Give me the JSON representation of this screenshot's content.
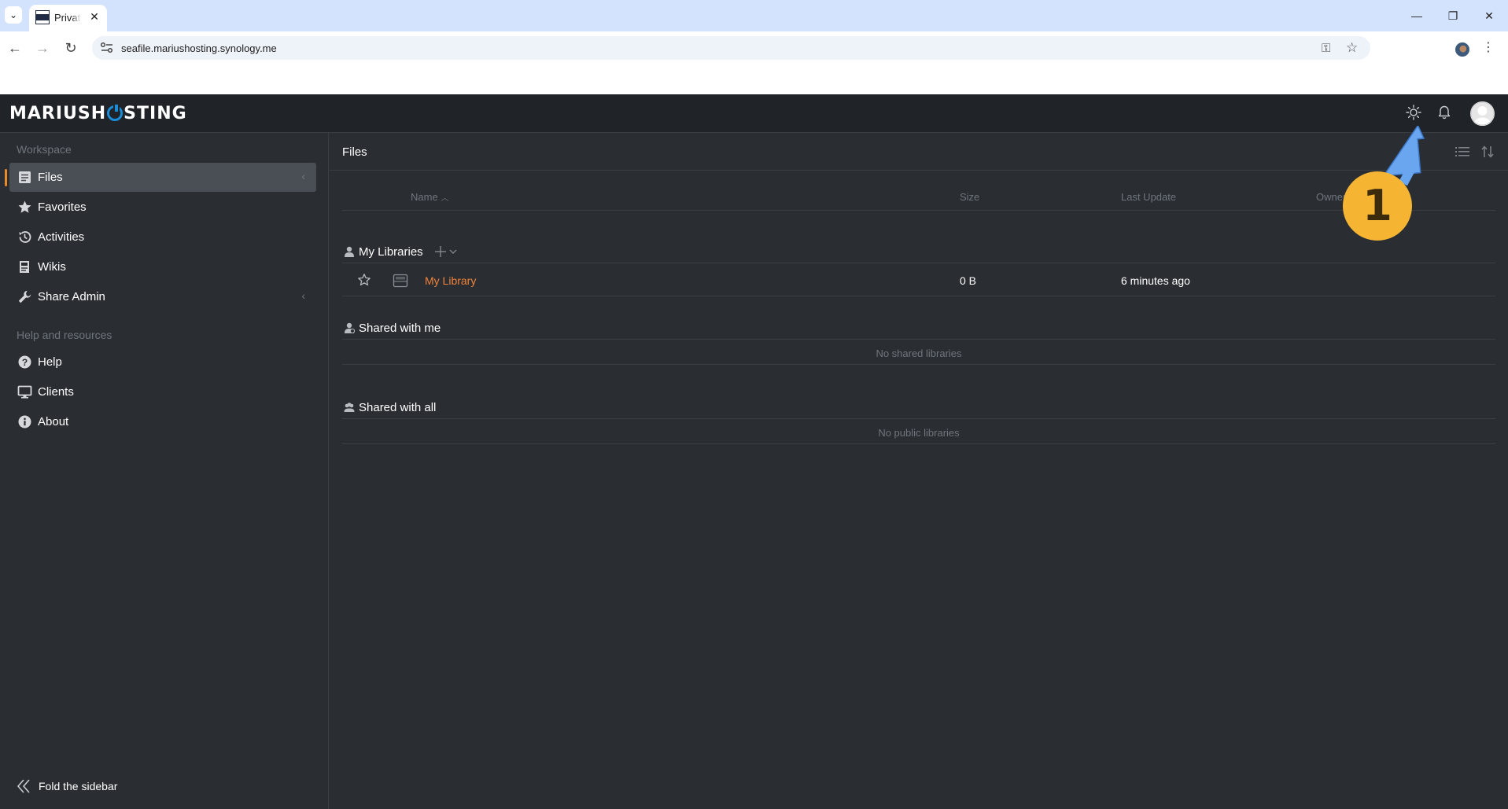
{
  "browser": {
    "tab_title": "Private",
    "url": "seafile.mariushosting.synology.me"
  },
  "app": {
    "logo_text_1": "MARIUSH",
    "logo_text_2": "STING",
    "brand_accent": "#1a8dd6",
    "active_accent": "#e8892a",
    "link_color": "#f0823a"
  },
  "sidebar": {
    "workspace_heading": "Workspace",
    "workspace_items": [
      {
        "label": "Files",
        "icon": "files-icon",
        "active": true
      },
      {
        "label": "Favorites",
        "icon": "star-icon"
      },
      {
        "label": "Activities",
        "icon": "history-icon"
      },
      {
        "label": "Wikis",
        "icon": "wiki-icon"
      },
      {
        "label": "Share Admin",
        "icon": "wrench-icon"
      }
    ],
    "help_heading": "Help and resources",
    "help_items": [
      {
        "label": "Help",
        "icon": "question-icon"
      },
      {
        "label": "Clients",
        "icon": "monitor-icon"
      },
      {
        "label": "About",
        "icon": "info-icon"
      }
    ],
    "fold_label": "Fold the sidebar"
  },
  "main": {
    "title": "Files",
    "columns": {
      "name": "Name",
      "size": "Size",
      "last_update": "Last Update",
      "owner": "Owner"
    },
    "my_libraries": {
      "title": "My Libraries",
      "rows": [
        {
          "name": "My Library",
          "size": "0 B",
          "last_update": "6 minutes ago"
        }
      ]
    },
    "shared_with_me": {
      "title": "Shared with me",
      "empty": "No shared libraries"
    },
    "shared_with_all": {
      "title": "Shared with all",
      "empty": "No public libraries"
    }
  },
  "annotation": {
    "number": "1",
    "badge_color": "#f5b533",
    "arrow_color": "#6aa6f0"
  }
}
